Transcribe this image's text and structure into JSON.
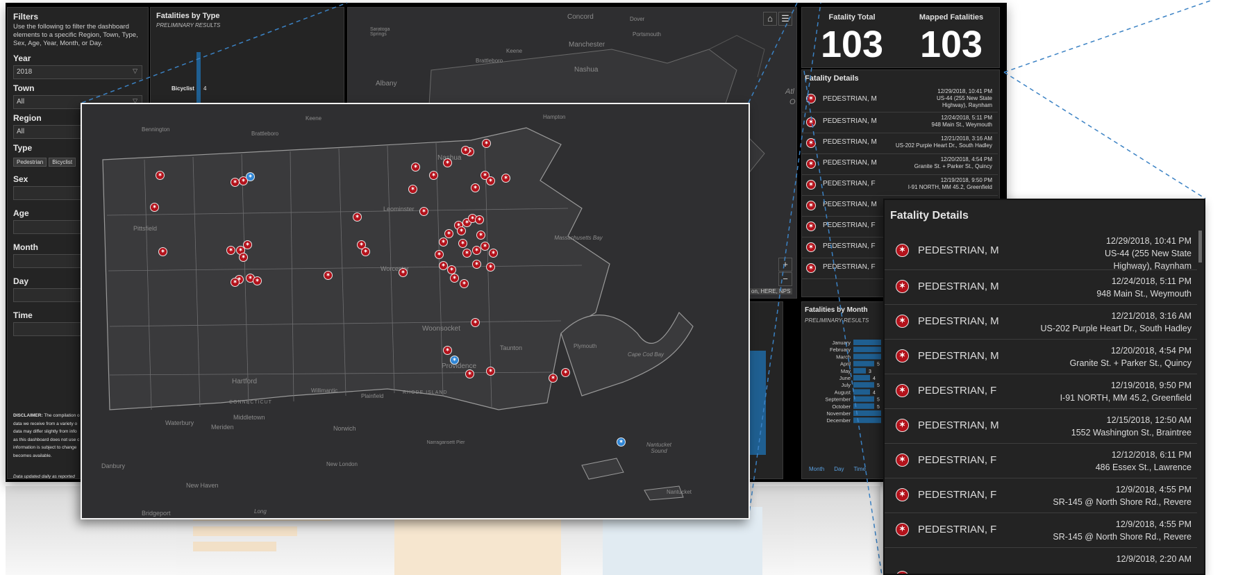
{
  "filters": {
    "title": "Filters",
    "description": "Use the following to filter the dashboard elements to a specific Region, Town, Type, Sex, Age, Year, Month, or Day.",
    "year_label": "Year",
    "year_value": "2018",
    "town_label": "Town",
    "town_value": "All",
    "region_label": "Region",
    "region_value": "All",
    "type_label": "Type",
    "type_chips": [
      "Pedestrian",
      "Bicyclist"
    ],
    "sex_label": "Sex",
    "age_label": "Age",
    "month_label": "Month",
    "day_label": "Day",
    "time_label": "Time",
    "disclaimer_lead": "DISCLAIMER:",
    "disclaimer_lines": [
      "The compilation o",
      "data we receive from a variety o",
      "data may differ slightly from info",
      "as this dashboard does not use c",
      "information is subject to change",
      "becomes available."
    ],
    "updated_note": "Data updated daily as reported"
  },
  "type_panel": {
    "title": "Fatalities by Type",
    "subtitle": "PRELIMINARY RESULTS",
    "bicyclist_label": "Bicyclist",
    "bicyclist_value": "4"
  },
  "stats": {
    "total_label": "Fatality Total",
    "total_value": "103",
    "mapped_label": "Mapped Fatalities",
    "mapped_value": "103"
  },
  "details": {
    "title": "Fatality Details",
    "rows": [
      {
        "name": "PEDESTRIAN, M",
        "date": "12/29/2018, 10:41 PM",
        "loc1": "US-44 (255 New State",
        "loc2": "Highway), Raynham"
      },
      {
        "name": "PEDESTRIAN, M",
        "date": "12/24/2018, 5:11 PM",
        "loc1": "948 Main St., Weymouth",
        "loc2": ""
      },
      {
        "name": "PEDESTRIAN, M",
        "date": "12/21/2018, 3:16 AM",
        "loc1": "US-202 Purple Heart Dr., South Hadley",
        "loc2": ""
      },
      {
        "name": "PEDESTRIAN, M",
        "date": "12/20/2018, 4:54 PM",
        "loc1": "Granite St. + Parker St., Quincy",
        "loc2": ""
      },
      {
        "name": "PEDESTRIAN, F",
        "date": "12/19/2018, 9:50 PM",
        "loc1": "I-91 NORTH, MM 45.2, Greenfield",
        "loc2": ""
      },
      {
        "name": "PEDESTRIAN, M",
        "date": "12/15/2018, 12:50 AM",
        "loc1": "1552 Washington St., Braintree",
        "loc2": ""
      },
      {
        "name": "PEDESTRIAN, F",
        "date": "12/12/2018, 6:11 PM",
        "loc1": "486 Essex St., Lawrence",
        "loc2": ""
      },
      {
        "name": "PEDESTRIAN, F",
        "date": "12/9/2018, 4:55 PM",
        "loc1": "SR-145 @ North Shore Rd., Revere",
        "loc2": ""
      },
      {
        "name": "PEDESTRIAN, F",
        "date": "12/9/2018, 4:55 PM",
        "loc1": "SR-145 @ North Shore Rd., Revere",
        "loc2": ""
      },
      {
        "name": "",
        "date": "12/9/2018, 2:20 AM",
        "loc1": "",
        "loc2": ""
      }
    ]
  },
  "month_panel": {
    "title": "Fatalities by Month",
    "subtitle": "PRELIMINARY RESULTS",
    "months": [
      "January",
      "February",
      "March",
      "April",
      "May",
      "June",
      "July",
      "August",
      "September",
      "October",
      "November",
      "December"
    ],
    "shown_values": [
      "",
      "",
      "",
      "5",
      "3",
      "4",
      "5",
      "4",
      "5",
      "5",
      "",
      ""
    ],
    "tabs": [
      "Month",
      "Day",
      "Time"
    ]
  },
  "map": {
    "attribution": "on, HERE, NPS",
    "places_small": [
      "Concord",
      "Dover",
      "Portsmouth",
      "Manchester",
      "Keene",
      "Brattleboro",
      "Nashua",
      "Albany",
      "Saratoga Springs",
      "Atl",
      "O"
    ],
    "places_large": [
      "Bennington",
      "Brattleboro",
      "Keene",
      "Hampton",
      "Nashua",
      "Pittsfield",
      "Leominster",
      "Worcester",
      "Massachusetts Bay",
      "Woonsocket",
      "Plymouth",
      "Taunton",
      "Cape Cod Bay",
      "Providence",
      "Hartford",
      "Willimantic",
      "Plainfield",
      "RHODE ISLAND",
      "CONNECTICUT",
      "Middletown",
      "Waterbury",
      "Meriden",
      "Norwich",
      "Narragansett Pier",
      "New London",
      "Nantucket Sound",
      "Nantucket",
      "Danbury",
      "New Haven",
      "Bridgeport",
      "Long"
    ],
    "zoom_in": "+",
    "zoom_out": "−"
  },
  "colors": {
    "panel_bg": "#242424",
    "pedestrian_marker": "#b3121b",
    "bicyclist_marker": "#2f86d6",
    "bar_blue": "#1f5f91",
    "guide_line": "#3b82c4"
  },
  "icons": [
    "pedestrian-icon",
    "bicyclist-icon",
    "home-icon",
    "list-icon",
    "chevron-down-icon"
  ]
}
